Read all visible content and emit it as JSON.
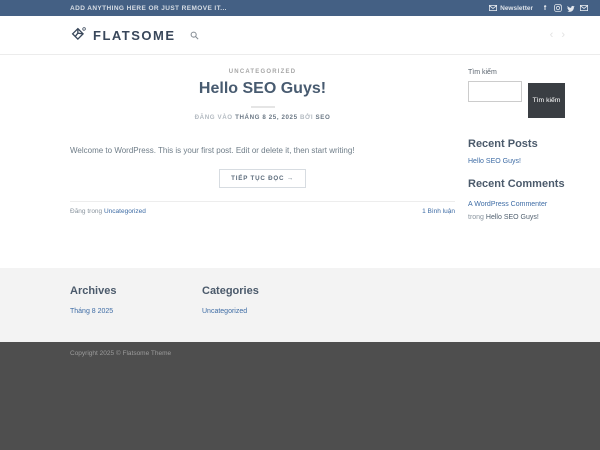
{
  "topbar": {
    "left_text": "ADD ANYTHING HERE OR JUST REMOVE IT...",
    "newsletter_label": "Newsletter",
    "social_icons": [
      "facebook",
      "instagram",
      "twitter",
      "email"
    ]
  },
  "header": {
    "logo_text": "FLATSOME",
    "icons": [
      "search-icon",
      "prev-arrow",
      "next-arrow"
    ],
    "prev_arrow": "‹",
    "next_arrow": "›"
  },
  "post": {
    "category": "UNCATEGORIZED",
    "title": "Hello SEO Guys!",
    "meta_prefix": "ĐĂNG VÀO",
    "meta_date": "THÁNG 8 25, 2025",
    "meta_by": "BỞI",
    "meta_author": "SEO",
    "excerpt": "Welcome to WordPress. This is your first post. Edit or delete it, then start writing!",
    "read_more_label": "TIẾP TỤC ĐỌC →",
    "posted_in_prefix": "Đăng trong",
    "posted_in_link": "Uncategorized",
    "comments_link": "1 Bình luận"
  },
  "sidebar": {
    "search_label": "Tìm kiếm",
    "search_button_label": "Tìm kiếm",
    "search_value": "",
    "recent_posts_title": "Recent Posts",
    "recent_posts": [
      "Hello SEO Guys!"
    ],
    "recent_comments_title": "Recent Comments",
    "recent_comment": {
      "author": "A WordPress Commenter",
      "connector": "trong",
      "post": "Hello SEO Guys!"
    }
  },
  "footer": {
    "archives_title": "Archives",
    "archives": [
      "Tháng 8 2025"
    ],
    "categories_title": "Categories",
    "categories": [
      "Uncategorized"
    ],
    "copyright": "Copyright 2025 © Flatsome Theme"
  },
  "colors": {
    "topbar_bg": "#446084",
    "link_blue": "#3e6ca5",
    "heading": "#4b5a6b",
    "search_button_bg": "#3a3e43",
    "footer_widgets_bg": "#f3f3f3",
    "absolute_footer_bg": "#4e4e4e"
  }
}
